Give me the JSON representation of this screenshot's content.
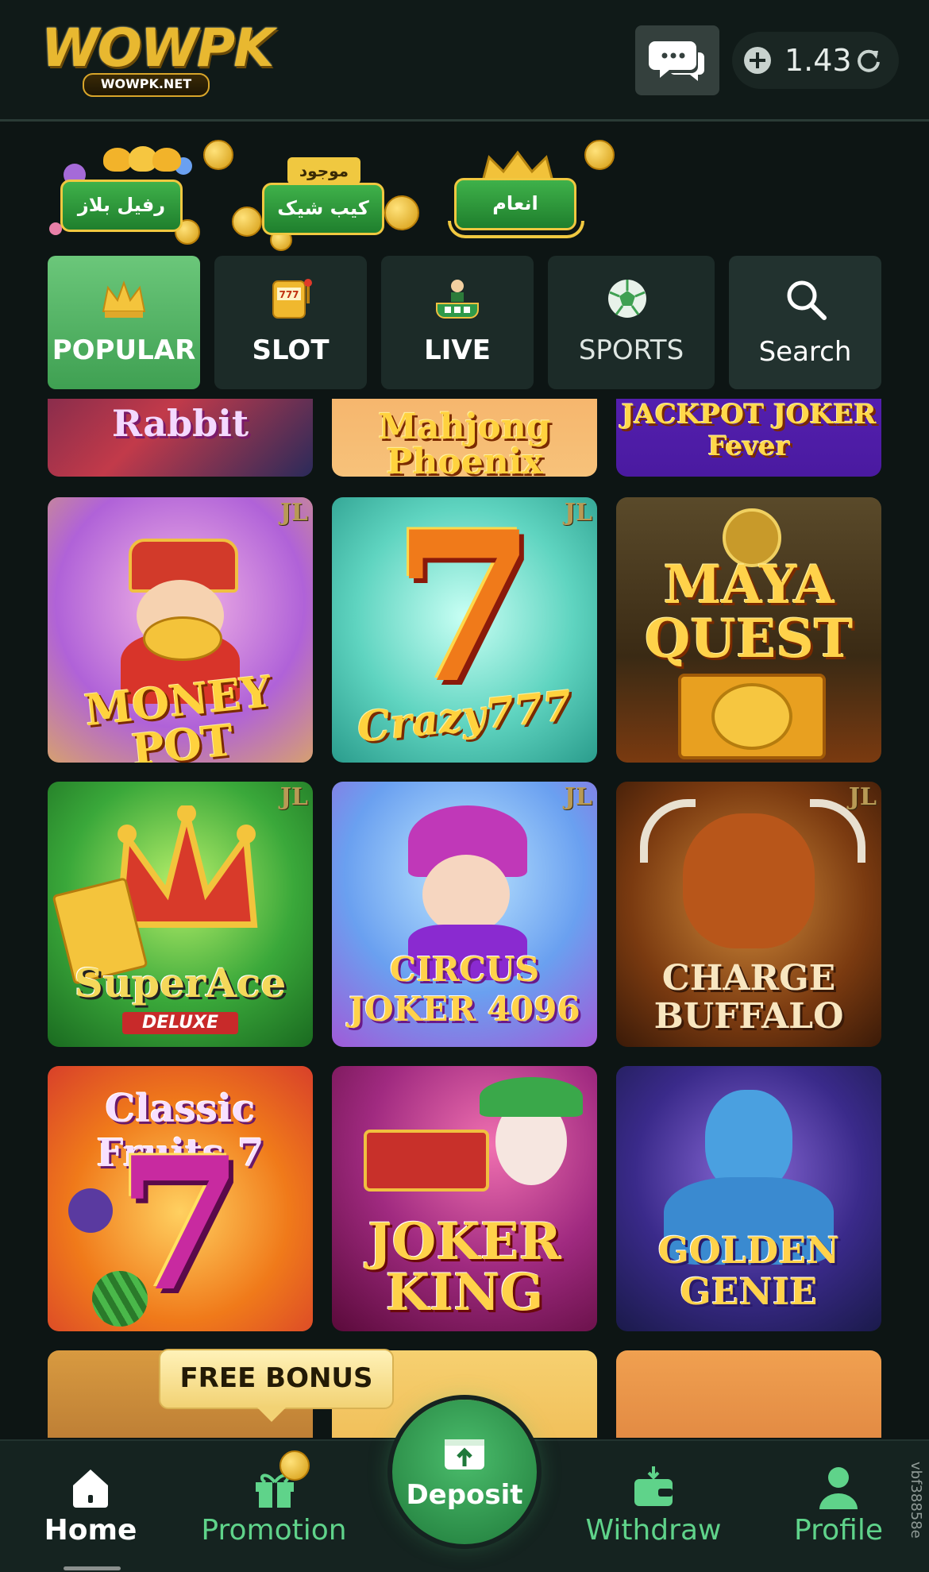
{
  "header": {
    "logo_text": "WOWPK",
    "logo_subtext": "WOWPK.NET",
    "balance": "1.43"
  },
  "promos": [
    {
      "label": "رفیل بلاز"
    },
    {
      "label": "کیب شیک",
      "tag": "موجود"
    },
    {
      "label": "انعام"
    }
  ],
  "tabs": [
    {
      "label": "POPULAR",
      "icon": "crown-icon"
    },
    {
      "label": "SLOT",
      "icon": "slot-machine-icon"
    },
    {
      "label": "LIVE",
      "icon": "live-dealer-icon"
    },
    {
      "label": "SPORTS",
      "icon": "soccer-ball-icon"
    },
    {
      "label": "Search",
      "icon": "search-icon"
    }
  ],
  "games_partial_top": [
    {
      "title": "Rabbit"
    },
    {
      "title": "Mahjong Phoenix"
    },
    {
      "title": "JACKPOT JOKER Fever"
    }
  ],
  "games": [
    {
      "title": "MONEY POT",
      "provider": "JL"
    },
    {
      "title": "Crazy777",
      "provider": "JL"
    },
    {
      "title": "MAYA QUEST",
      "provider": ""
    },
    {
      "title": "SuperAce",
      "subtitle": "DELUXE",
      "provider": "JL"
    },
    {
      "title": "CIRCUS JOKER 4096",
      "provider": "JL"
    },
    {
      "title": "CHARGE BUFFALO",
      "provider": "JL"
    },
    {
      "title": "Classic Fruits 7",
      "provider": ""
    },
    {
      "title": "JOKER KING",
      "provider": ""
    },
    {
      "title": "GOLDEN GENIE",
      "provider": ""
    }
  ],
  "free_bonus": "FREE BONUS",
  "bottom_nav": {
    "home": "Home",
    "promotion": "Promotion",
    "deposit": "Deposit",
    "withdraw": "Withdraw",
    "profile": "Profile"
  },
  "side_code": "vbf38858e",
  "colors": {
    "accent_green": "#3fa052",
    "nav_green": "#5fd38a",
    "gold": "#e8b830",
    "background": "#0d1514"
  }
}
